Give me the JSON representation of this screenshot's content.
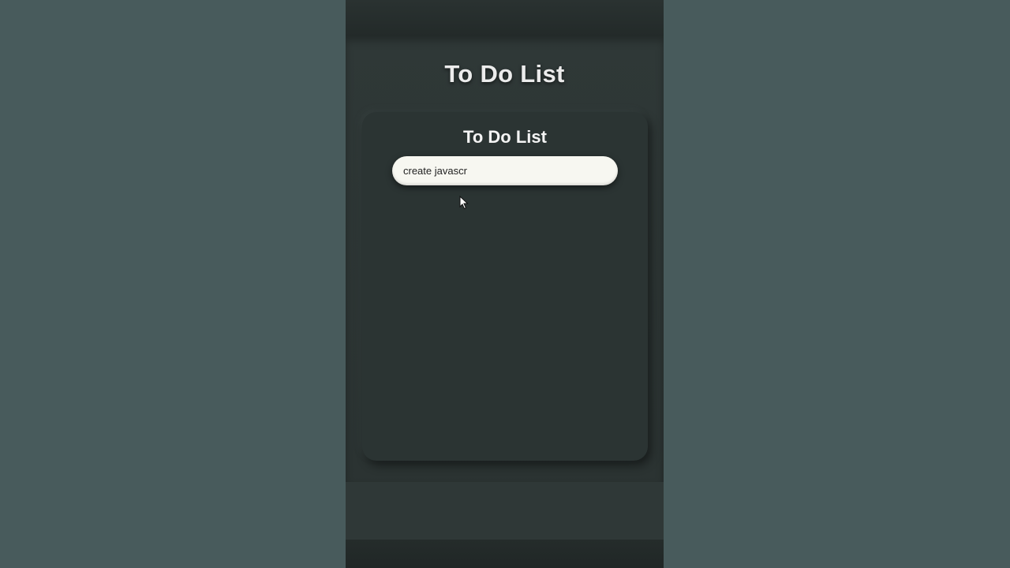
{
  "app": {
    "page_title": "To Do List",
    "card_title": "To Do List"
  },
  "todo_input": {
    "value": "create javascr",
    "placeholder": ""
  },
  "todo_items": [],
  "colors": {
    "outer_background": "#485b5c",
    "app_background": "#2c3534",
    "card_background": "#2b3433",
    "input_background": "#f7f7f1",
    "title_text": "#ececec"
  },
  "icons": {
    "pointer": "mouse-pointer-icon"
  }
}
